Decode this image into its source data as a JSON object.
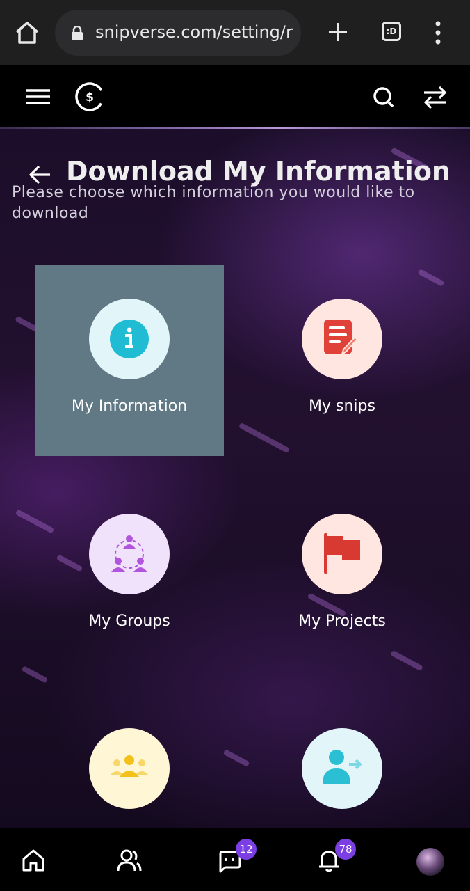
{
  "browser": {
    "url": "snipverse.com/setting/r",
    "tab_icon_text": ":D"
  },
  "page": {
    "title": "Download My Information",
    "subtitle": "Please choose which information you would like to download"
  },
  "tiles": [
    {
      "label": "My Information",
      "icon": "info-icon",
      "color": "#e2f6f9",
      "icon_color": "#1fbcd3",
      "selected": true
    },
    {
      "label": "My snips",
      "icon": "document-edit-icon",
      "color": "#ffe6e1",
      "icon_color": "#e0423a",
      "selected": false
    },
    {
      "label": "My Groups",
      "icon": "groups-icon",
      "color": "#f1e2fb",
      "icon_color": "#b155dd",
      "selected": false
    },
    {
      "label": "My Projects",
      "icon": "flag-icon",
      "color": "#ffe6e1",
      "icon_color": "#d83a32",
      "selected": false
    },
    {
      "label": "",
      "icon": "team-icon",
      "color": "#fff6d6",
      "icon_color": "#f2c21a",
      "selected": false
    },
    {
      "label": "",
      "icon": "user-share-icon",
      "color": "#e2f6f9",
      "icon_color": "#2bbfd4",
      "selected": false
    }
  ],
  "bottom_nav": {
    "messages_badge": "12",
    "notifications_badge": "78"
  },
  "colors": {
    "accent": "#7b3fe4",
    "selected_tile": "#617985"
  }
}
